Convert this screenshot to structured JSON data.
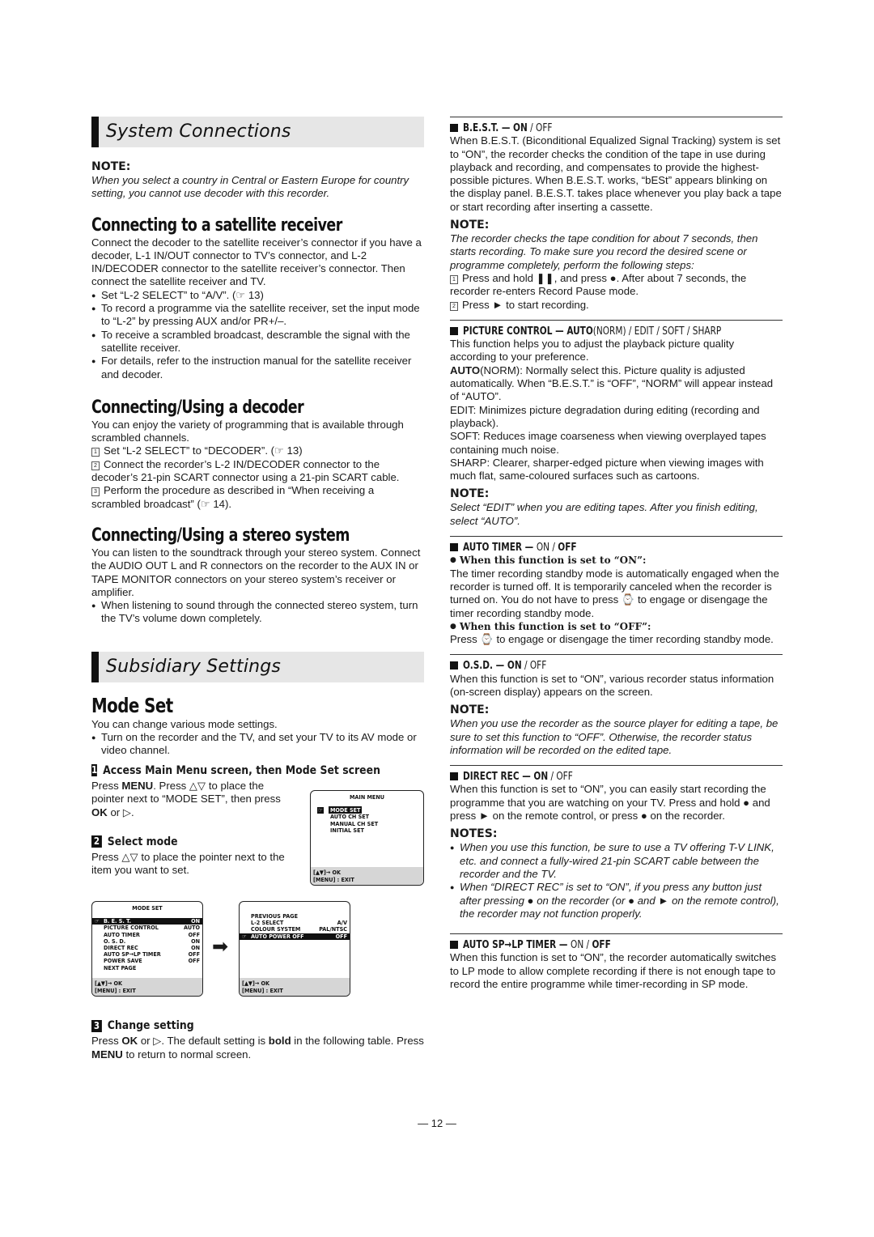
{
  "left": {
    "system_connections": {
      "banner": "System Connections",
      "note_heading": "NOTE:",
      "note_text": "When you select a country in Central or Eastern Europe for country setting, you cannot use decoder with this recorder."
    },
    "satellite": {
      "heading": "Connecting to a satellite receiver",
      "intro": "Connect the decoder to the satellite receiver’s connector if you have a decoder, L-1 IN/OUT connector to TV’s connector, and L-2 IN/DECODER connector to the satellite receiver’s connector. Then connect the satellite receiver and TV.",
      "bullets": [
        "Set “L-2 SELECT” to “A/V”. (☞ 13)",
        "To record a programme via the satellite receiver, set the input mode to “L-2” by pressing AUX and/or PR+/–.",
        "To receive a scrambled broadcast, descramble the signal with the satellite receiver.",
        "For details, refer to the instruction manual for the satellite receiver and decoder."
      ]
    },
    "decoder": {
      "heading": "Connecting/Using a decoder",
      "intro": "You can enjoy the variety of programming that is available through scrambled channels.",
      "steps": [
        {
          "num": "1",
          "text": "Set “L-2 SELECT” to “DECODER”. (☞ 13)"
        },
        {
          "num": "2",
          "text": "Connect the recorder’s L-2 IN/DECODER connector to the decoder’s 21-pin SCART connector using a 21-pin SCART cable."
        },
        {
          "num": "3",
          "text": "Perform the procedure as described in “When receiving a scrambled broadcast” (☞ 14)."
        }
      ]
    },
    "stereo": {
      "heading": "Connecting/Using a stereo system",
      "intro": "You can listen to the soundtrack through your stereo system. Connect the AUDIO OUT L and R connectors on the recorder to the AUX IN or TAPE MONITOR connectors on your stereo system’s receiver or amplifier.",
      "bullet": "When listening to sound through the connected stereo system, turn the TV’s volume down completely."
    },
    "subsidiary": {
      "banner": "Subsidiary Settings"
    },
    "mode_set": {
      "heading": "Mode Set",
      "intro": "You can change various mode settings.",
      "bullet": "Turn on the recorder and the TV, and set your TV to its AV mode or video channel.",
      "step1": {
        "num": "1",
        "title": "Access Main Menu screen, then Mode Set screen",
        "text_a": "Press ",
        "menu": "MENU",
        "text_b": ". Press △▽ to place the pointer next to “MODE SET”, then press ",
        "ok": "OK",
        "text_c": " or ▷."
      },
      "step2": {
        "num": "2",
        "title": "Select mode",
        "text": "Press △▽ to place the pointer next to the item you want to set."
      },
      "step3": {
        "num": "3",
        "title": "Change setting",
        "text_a": "Press ",
        "ok": "OK",
        "text_b": " or ▷. The default setting is ",
        "bold": "bold",
        "text_c": " in the following table. Press ",
        "menu": "MENU",
        "text_d": " to return to normal screen."
      }
    },
    "screens": {
      "main_menu": {
        "title": "MAIN MENU",
        "items": [
          "MODE SET",
          "AUTO CH SET",
          "MANUAL CH SET",
          "INITIAL SET"
        ],
        "selected": 0,
        "foot1": "[▲▼]→ OK",
        "foot2": "[MENU] : EXIT"
      },
      "mode_set_1": {
        "title": "MODE SET",
        "rows": [
          {
            "label": "B. E. S. T.",
            "value": "ON"
          },
          {
            "label": "PICTURE CONTROL",
            "value": "AUTO"
          },
          {
            "label": "AUTO TIMER",
            "value": "OFF"
          },
          {
            "label": "O. S. D.",
            "value": "ON"
          },
          {
            "label": "DIRECT REC",
            "value": "ON"
          },
          {
            "label": "AUTO SP→LP TIMER",
            "value": "OFF"
          },
          {
            "label": "POWER SAVE",
            "value": "OFF"
          },
          {
            "label": "NEXT PAGE",
            "value": ""
          }
        ],
        "foot1": "[▲▼]→ OK",
        "foot2": "[MENU] : EXIT"
      },
      "mode_set_2": {
        "rows": [
          {
            "label": "PREVIOUS PAGE",
            "value": ""
          },
          {
            "label": "L-2 SELECT",
            "value": "A/V"
          },
          {
            "label": "COLOUR SYSTEM",
            "value": "PAL/NTSC"
          },
          {
            "label": "AUTO POWER OFF",
            "value": "OFF"
          }
        ],
        "foot1": "[▲▼]→ OK",
        "foot2": "[MENU] : EXIT"
      },
      "arrow": "➡"
    }
  },
  "right": {
    "best": {
      "name": "B.E.S.T. — ",
      "on": "ON",
      "sep": " / ",
      "off": "OFF",
      "text": "When B.E.S.T. (Biconditional Equalized Signal Tracking) system is set to “ON”, the recorder checks the condition of the tape in use during playback and recording, and compensates to provide the highest-possible pictures. When B.E.S.T. works, “bESt” appears blinking on the display panel. B.E.S.T. takes place whenever you play back a tape or start recording after inserting a cassette.",
      "note_heading": "NOTE:",
      "note_text": "The recorder checks the tape condition for about 7 seconds, then starts recording. To make sure you record the desired scene or programme completely, perform the following steps:",
      "steps": [
        {
          "num": "1",
          "text": "Press and hold ❚❚, and press ●. After about 7 seconds, the recorder re-enters Record Pause mode."
        },
        {
          "num": "2",
          "text": "Press ► to start recording."
        }
      ]
    },
    "picture": {
      "name": "PICTURE CONTROL — ",
      "auto": "AUTO",
      "rest": "(NORM) / EDIT / SOFT / SHARP",
      "text": "This function helps you to adjust the playback picture quality according to your preference.",
      "options": [
        {
          "key": "AUTO",
          "key_rest": "(NORM)",
          "text": ": Normally select this. Picture quality is adjusted automatically. When “B.E.S.T.” is “OFF”, “NORM” will appear instead of “AUTO”."
        },
        {
          "key": "",
          "key_rest": "EDIT",
          "text": ": Minimizes picture degradation during editing (recording and playback)."
        },
        {
          "key": "",
          "key_rest": "SOFT",
          "text": ": Reduces image coarseness when viewing overplayed tapes containing much noise."
        },
        {
          "key": "",
          "key_rest": "SHARP",
          "text": ": Clearer, sharper-edged picture when viewing images with much flat, same-coloured surfaces such as cartoons."
        }
      ],
      "note_heading": "NOTE:",
      "note_text": "Select “EDIT” when you are editing tapes. After you finish editing, select “AUTO”."
    },
    "auto_timer": {
      "name": "AUTO TIMER — ",
      "on": "ON",
      "sep": " / ",
      "off": "OFF",
      "on_heading": "When this function is set to “ON”:",
      "on_text": "The timer recording standby mode is automatically engaged when the recorder is turned off. It is temporarily canceled when the recorder is turned on. You do not have to press ⌚ to engage or disengage the timer recording standby mode.",
      "off_heading": "When this function is set to “OFF”:",
      "off_text": "Press ⌚ to engage or disengage the timer recording standby mode."
    },
    "osd": {
      "name": "O.S.D. — ",
      "on": "ON",
      "sep": " / ",
      "off": "OFF",
      "text": "When this function is set to “ON”, various recorder status information (on-screen display) appears on the screen.",
      "note_heading": "NOTE:",
      "note_text": "When you use the recorder as the source player for editing a tape, be sure to set this function to “OFF”. Otherwise, the recorder status information will be recorded on the edited tape."
    },
    "direct_rec": {
      "name": "DIRECT REC — ",
      "on": "ON",
      "sep": " / ",
      "off": "OFF",
      "text": "When this function is set to “ON”, you can easily start recording the programme that you are watching on your TV. Press and hold ● and press ► on the remote control, or press ● on the recorder.",
      "notes_heading": "NOTES:",
      "notes": [
        "When you use this function, be sure to use a TV offering T-V LINK, etc. and connect a fully-wired 21-pin SCART cable between the recorder and the TV.",
        "When “DIRECT REC” is set to “ON”, if you press any button just after pressing ● on the recorder (or ● and ► on the remote control), the recorder may not function properly."
      ]
    },
    "sp_lp": {
      "name": "AUTO SP→LP TIMER — ",
      "on": "ON",
      "sep": " / ",
      "off": "OFF",
      "text": "When this function is set to “ON”, the recorder automatically switches to LP mode to allow complete recording if there is not enough tape to record the entire programme while timer-recording in SP mode."
    }
  },
  "page_number": "— 12 —"
}
